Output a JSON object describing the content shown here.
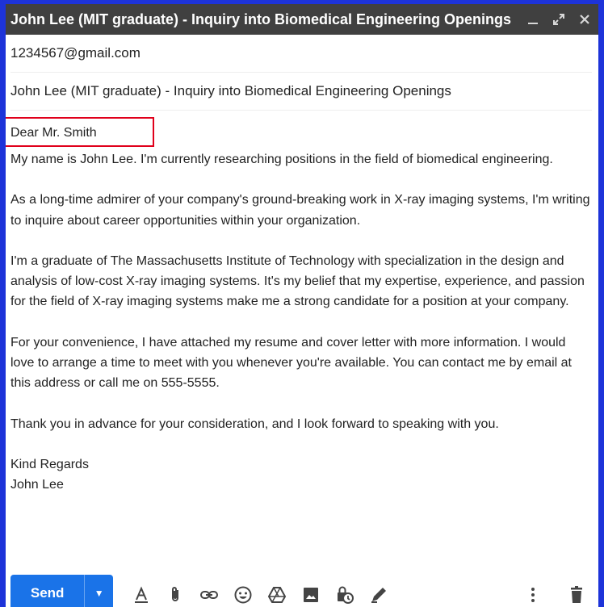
{
  "window": {
    "title": "John Lee (MIT graduate) - Inquiry into Biomedical Engineering Openings",
    "controls": [
      "minimize-icon",
      "fullscreen-icon",
      "close-icon"
    ]
  },
  "compose": {
    "to": "1234567@gmail.com",
    "subject": "John Lee (MIT graduate) - Inquiry into Biomedical Engineering Openings",
    "greeting": "Dear Mr. Smith",
    "paragraphs": [
      "My name is John Lee. I'm currently researching positions in the field of biomedical engineering.",
      "As a long-time admirer of your company's ground-breaking work in X-ray imaging systems, I'm writing to inquire about career opportunities within your organization.",
      "I'm a graduate of The Massachusetts Institute of Technology with specialization in the design and analysis of low-cost X-ray imaging systems. It's my belief that my expertise, experience, and passion for the field of X-ray imaging systems make me a strong candidate for a position at your company.",
      "For your convenience, I have attached my resume and cover letter with more information. I would love to arrange a time to meet with you whenever you're available. You can contact me by email at this address or call me on 555-5555.",
      "Thank you in advance for your consideration, and I look forward to speaking with you."
    ],
    "closing": "Kind Regards",
    "signature": "John Lee"
  },
  "toolbar": {
    "send_label": "Send",
    "icons": [
      "format-text-icon",
      "attach-icon",
      "link-icon",
      "emoji-icon",
      "drive-icon",
      "photo-icon",
      "confidential-lock-icon",
      "signature-pen-icon"
    ],
    "right_icons": [
      "more-options-icon",
      "trash-icon"
    ]
  },
  "colors": {
    "frame": "#1d33d9",
    "titlebar": "#404040",
    "send": "#1a73e8",
    "highlight": "#e0001b"
  }
}
